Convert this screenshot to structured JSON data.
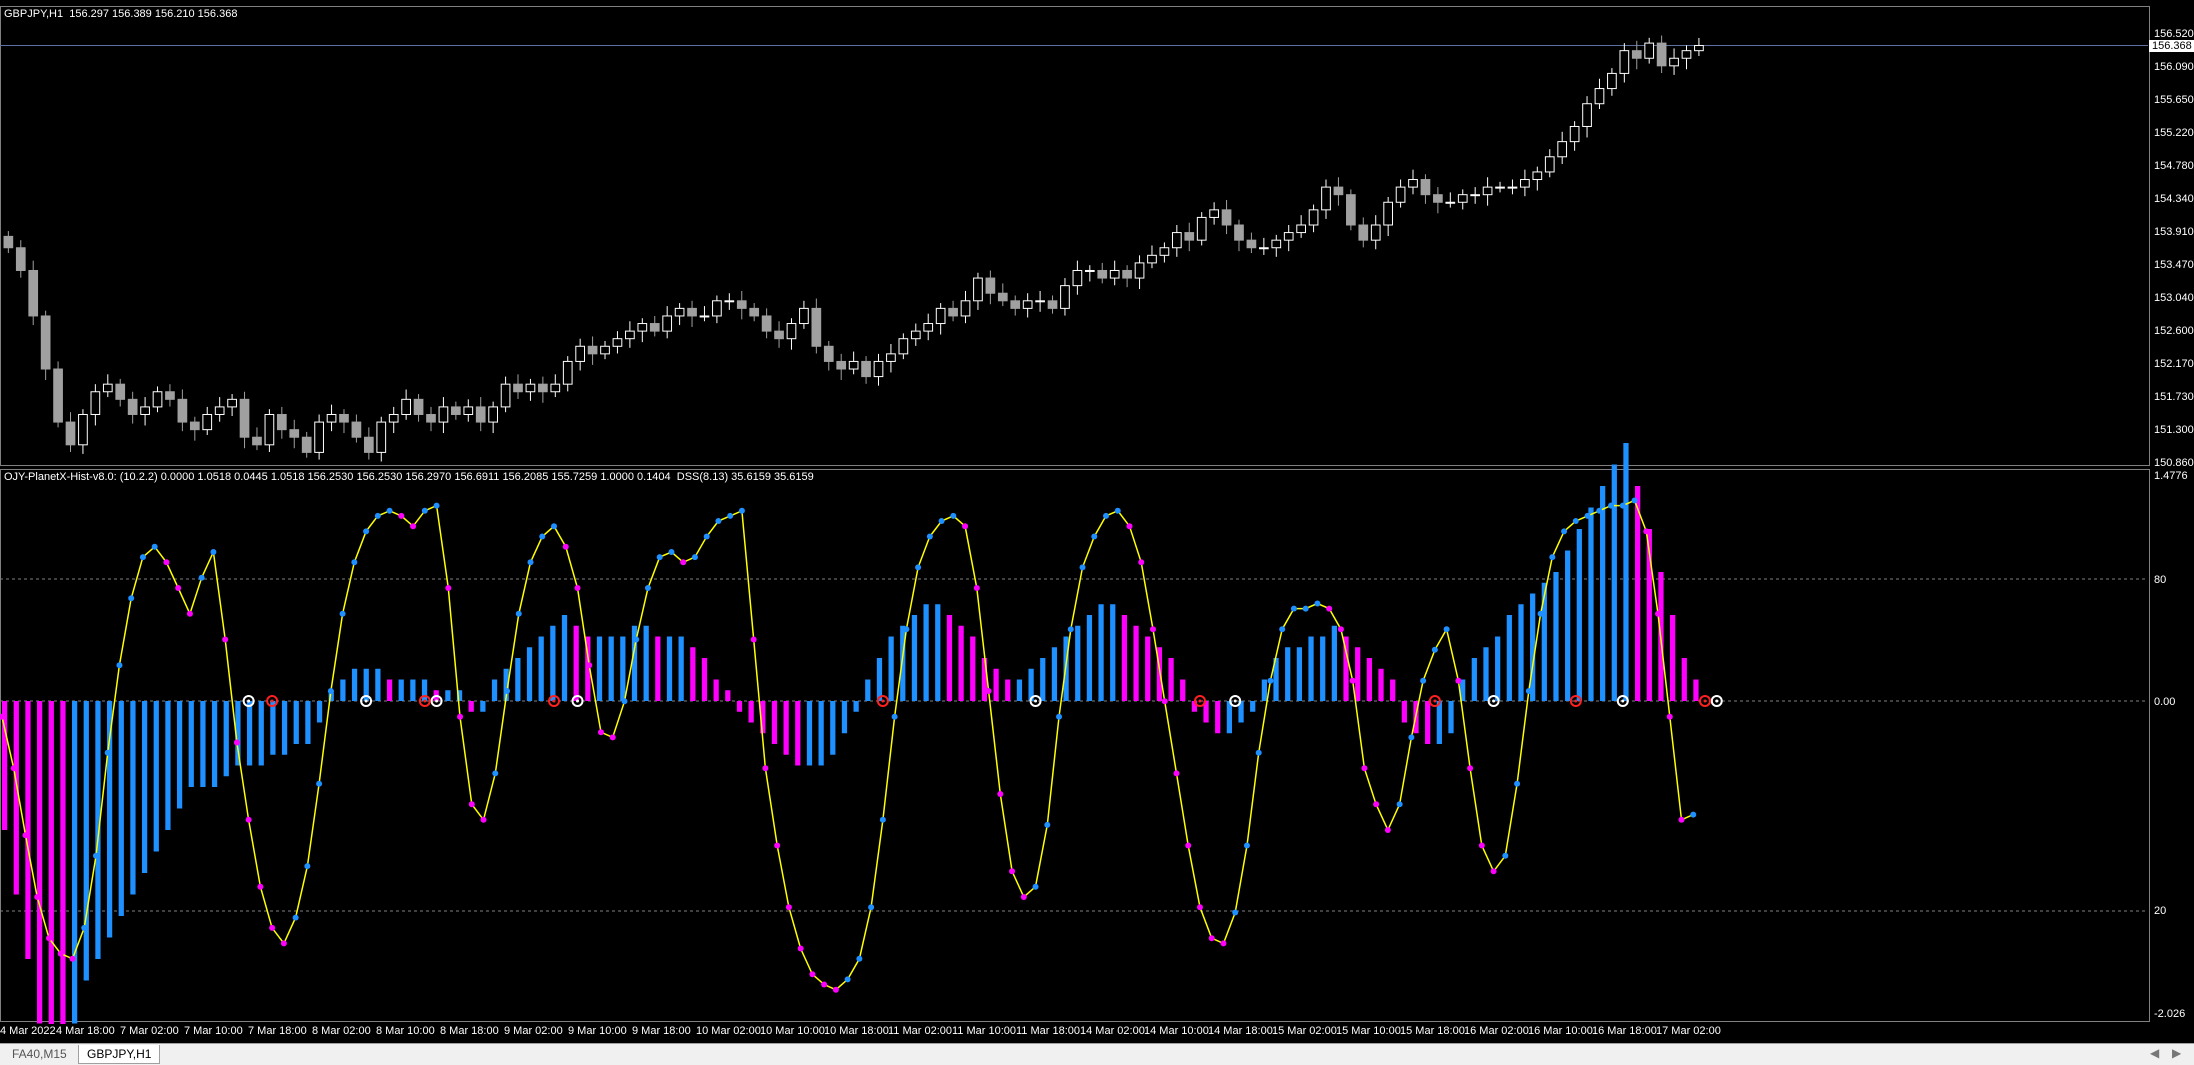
{
  "main_chart": {
    "header": "GBPJPY,H1  156.297 156.389 156.210 156.368",
    "current_price": "156.368",
    "price_axis": [
      "156.520",
      "156.090",
      "155.650",
      "155.220",
      "154.780",
      "154.340",
      "153.910",
      "153.470",
      "153.040",
      "152.600",
      "152.170",
      "151.730",
      "151.300",
      "150.860"
    ],
    "candles_close": [
      153.7,
      153.4,
      152.8,
      152.1,
      151.4,
      151.1,
      151.5,
      151.8,
      151.9,
      151.7,
      151.5,
      151.6,
      151.8,
      151.7,
      151.4,
      151.3,
      151.5,
      151.6,
      151.7,
      151.2,
      151.1,
      151.5,
      151.3,
      151.2,
      151.0,
      151.4,
      151.5,
      151.4,
      151.2,
      151.0,
      151.4,
      151.5,
      151.7,
      151.5,
      151.4,
      151.6,
      151.5,
      151.6,
      151.4,
      151.6,
      151.9,
      151.8,
      151.9,
      151.8,
      151.9,
      152.2,
      152.4,
      152.3,
      152.4,
      152.5,
      152.6,
      152.7,
      152.6,
      152.8,
      152.9,
      152.8,
      152.8,
      153.0,
      153.0,
      152.9,
      152.8,
      152.6,
      152.5,
      152.7,
      152.9,
      152.4,
      152.2,
      152.1,
      152.2,
      152.0,
      152.2,
      152.3,
      152.5,
      152.6,
      152.7,
      152.9,
      152.8,
      153.0,
      153.3,
      153.1,
      153.0,
      152.9,
      153.0,
      153.0,
      152.9,
      153.2,
      153.4,
      153.4,
      153.3,
      153.4,
      153.3,
      153.5,
      153.6,
      153.7,
      153.9,
      153.8,
      154.1,
      154.2,
      154.0,
      153.8,
      153.7,
      153.7,
      153.8,
      153.9,
      154.0,
      154.2,
      154.5,
      154.4,
      154.0,
      153.8,
      154.0,
      154.3,
      154.5,
      154.6,
      154.4,
      154.3,
      154.3,
      154.4,
      154.4,
      154.5,
      154.5,
      154.5,
      154.6,
      154.7,
      154.9,
      155.1,
      155.3,
      155.6,
      155.8,
      156.0,
      156.3,
      156.2,
      156.4,
      156.1,
      156.2,
      156.3,
      156.368
    ]
  },
  "indicator": {
    "header": "OJY-PlanetX-Hist-v8.0: (10.2.2) 0.0000 1.0518 0.0445 1.0518 156.2530 156.2530 156.2970 156.6911 156.2085 155.7259 1.0000 0.1404  DSS(8.13) 35.6159 35.6159",
    "axis": {
      "top": "1.4776",
      "upper": "80",
      "zero": "0.00",
      "lower": "20",
      "bottom": "-2.026"
    },
    "dss_values": [
      55,
      45,
      32,
      20,
      12,
      9,
      8,
      14,
      28,
      48,
      65,
      78,
      86,
      88,
      85,
      80,
      75,
      82,
      87,
      70,
      50,
      35,
      22,
      14,
      11,
      16,
      26,
      42,
      60,
      75,
      85,
      91,
      94,
      95,
      94,
      92,
      95,
      96,
      80,
      55,
      38,
      35,
      44,
      60,
      75,
      85,
      90,
      92,
      88,
      80,
      65,
      52,
      51,
      58,
      70,
      80,
      86,
      87,
      85,
      86,
      90,
      93,
      94,
      95,
      70,
      45,
      30,
      18,
      10,
      5,
      3,
      2,
      4,
      8,
      18,
      35,
      55,
      72,
      84,
      90,
      93,
      94,
      92,
      80,
      60,
      40,
      25,
      20,
      22,
      34,
      55,
      72,
      84,
      90,
      94,
      95,
      92,
      85,
      72,
      58,
      44,
      30,
      18,
      12,
      11,
      17,
      30,
      48,
      62,
      72,
      76,
      76,
      77,
      76,
      72,
      62,
      45,
      38,
      33,
      38,
      51,
      62,
      68,
      72,
      62,
      45,
      30,
      25,
      28,
      42,
      60,
      75,
      86,
      91,
      93,
      94,
      95,
      96,
      96,
      97,
      91,
      75,
      55,
      35,
      36
    ],
    "histogram": [
      -0.6,
      -0.9,
      -1.2,
      -1.5,
      -1.6,
      -1.7,
      -1.5,
      -1.3,
      -1.2,
      -1.1,
      -1.0,
      -0.9,
      -0.8,
      -0.7,
      -0.6,
      -0.5,
      -0.4,
      -0.4,
      -0.4,
      -0.35,
      -0.3,
      -0.3,
      -0.3,
      -0.25,
      -0.25,
      -0.2,
      -0.2,
      -0.1,
      0.05,
      0.1,
      0.15,
      0.15,
      0.15,
      0.1,
      0.1,
      0.1,
      0.1,
      0.05,
      0.05,
      0.05,
      -0.05,
      -0.05,
      0.1,
      0.15,
      0.2,
      0.25,
      0.3,
      0.35,
      0.4,
      0.35,
      0.3,
      0.3,
      0.3,
      0.3,
      0.35,
      0.35,
      0.3,
      0.3,
      0.3,
      0.25,
      0.2,
      0.1,
      0.05,
      -0.05,
      -0.1,
      -0.15,
      -0.2,
      -0.25,
      -0.3,
      -0.3,
      -0.3,
      -0.25,
      -0.15,
      -0.05,
      0.1,
      0.2,
      0.3,
      0.35,
      0.4,
      0.45,
      0.45,
      0.4,
      0.35,
      0.3,
      0.2,
      0.15,
      0.1,
      0.1,
      0.15,
      0.2,
      0.25,
      0.3,
      0.35,
      0.4,
      0.45,
      0.45,
      0.4,
      0.35,
      0.3,
      0.25,
      0.2,
      0.1,
      -0.05,
      -0.1,
      -0.15,
      -0.15,
      -0.1,
      -0.05,
      0.1,
      0.2,
      0.25,
      0.25,
      0.3,
      0.3,
      0.35,
      0.3,
      0.25,
      0.2,
      0.15,
      0.1,
      -0.1,
      -0.15,
      -0.2,
      -0.2,
      -0.15,
      0.1,
      0.2,
      0.25,
      0.3,
      0.4,
      0.45,
      0.5,
      0.55,
      0.6,
      0.7,
      0.8,
      0.9,
      1.0,
      1.1,
      1.2,
      1.0,
      0.8,
      0.6,
      0.4,
      0.2,
      0.1
    ],
    "white_markers": [
      21,
      31,
      37,
      49,
      88,
      105,
      127,
      138,
      146
    ],
    "red_markers": [
      23,
      36,
      47,
      75,
      102,
      122,
      134,
      145
    ]
  },
  "time_axis": [
    "4 Mar 2022",
    "4 Mar 18:00",
    "7 Mar 02:00",
    "7 Mar 10:00",
    "7 Mar 18:00",
    "8 Mar 02:00",
    "8 Mar 10:00",
    "8 Mar 18:00",
    "9 Mar 02:00",
    "9 Mar 10:00",
    "9 Mar 18:00",
    "10 Mar 02:00",
    "10 Mar 10:00",
    "10 Mar 18:00",
    "11 Mar 02:00",
    "11 Mar 10:00",
    "11 Mar 18:00",
    "14 Mar 02:00",
    "14 Mar 10:00",
    "14 Mar 18:00",
    "15 Mar 02:00",
    "15 Mar 10:00",
    "15 Mar 18:00",
    "16 Mar 02:00",
    "16 Mar 10:00",
    "16 Mar 18:00",
    "17 Mar 02:00"
  ],
  "tabs": [
    {
      "label": "FA40,M15",
      "active": false
    },
    {
      "label": "GBPJPY,H1",
      "active": true
    }
  ],
  "colors": {
    "bull_candle": "#ffffff",
    "bear_candle": "#a0a0a0",
    "hist_up": "#1e90ff",
    "hist_down": "#ff00ff",
    "dss_line": "#ffff00",
    "dot_up": "#1e90ff",
    "dot_down": "#ff00ff",
    "level_line": "#808080"
  }
}
